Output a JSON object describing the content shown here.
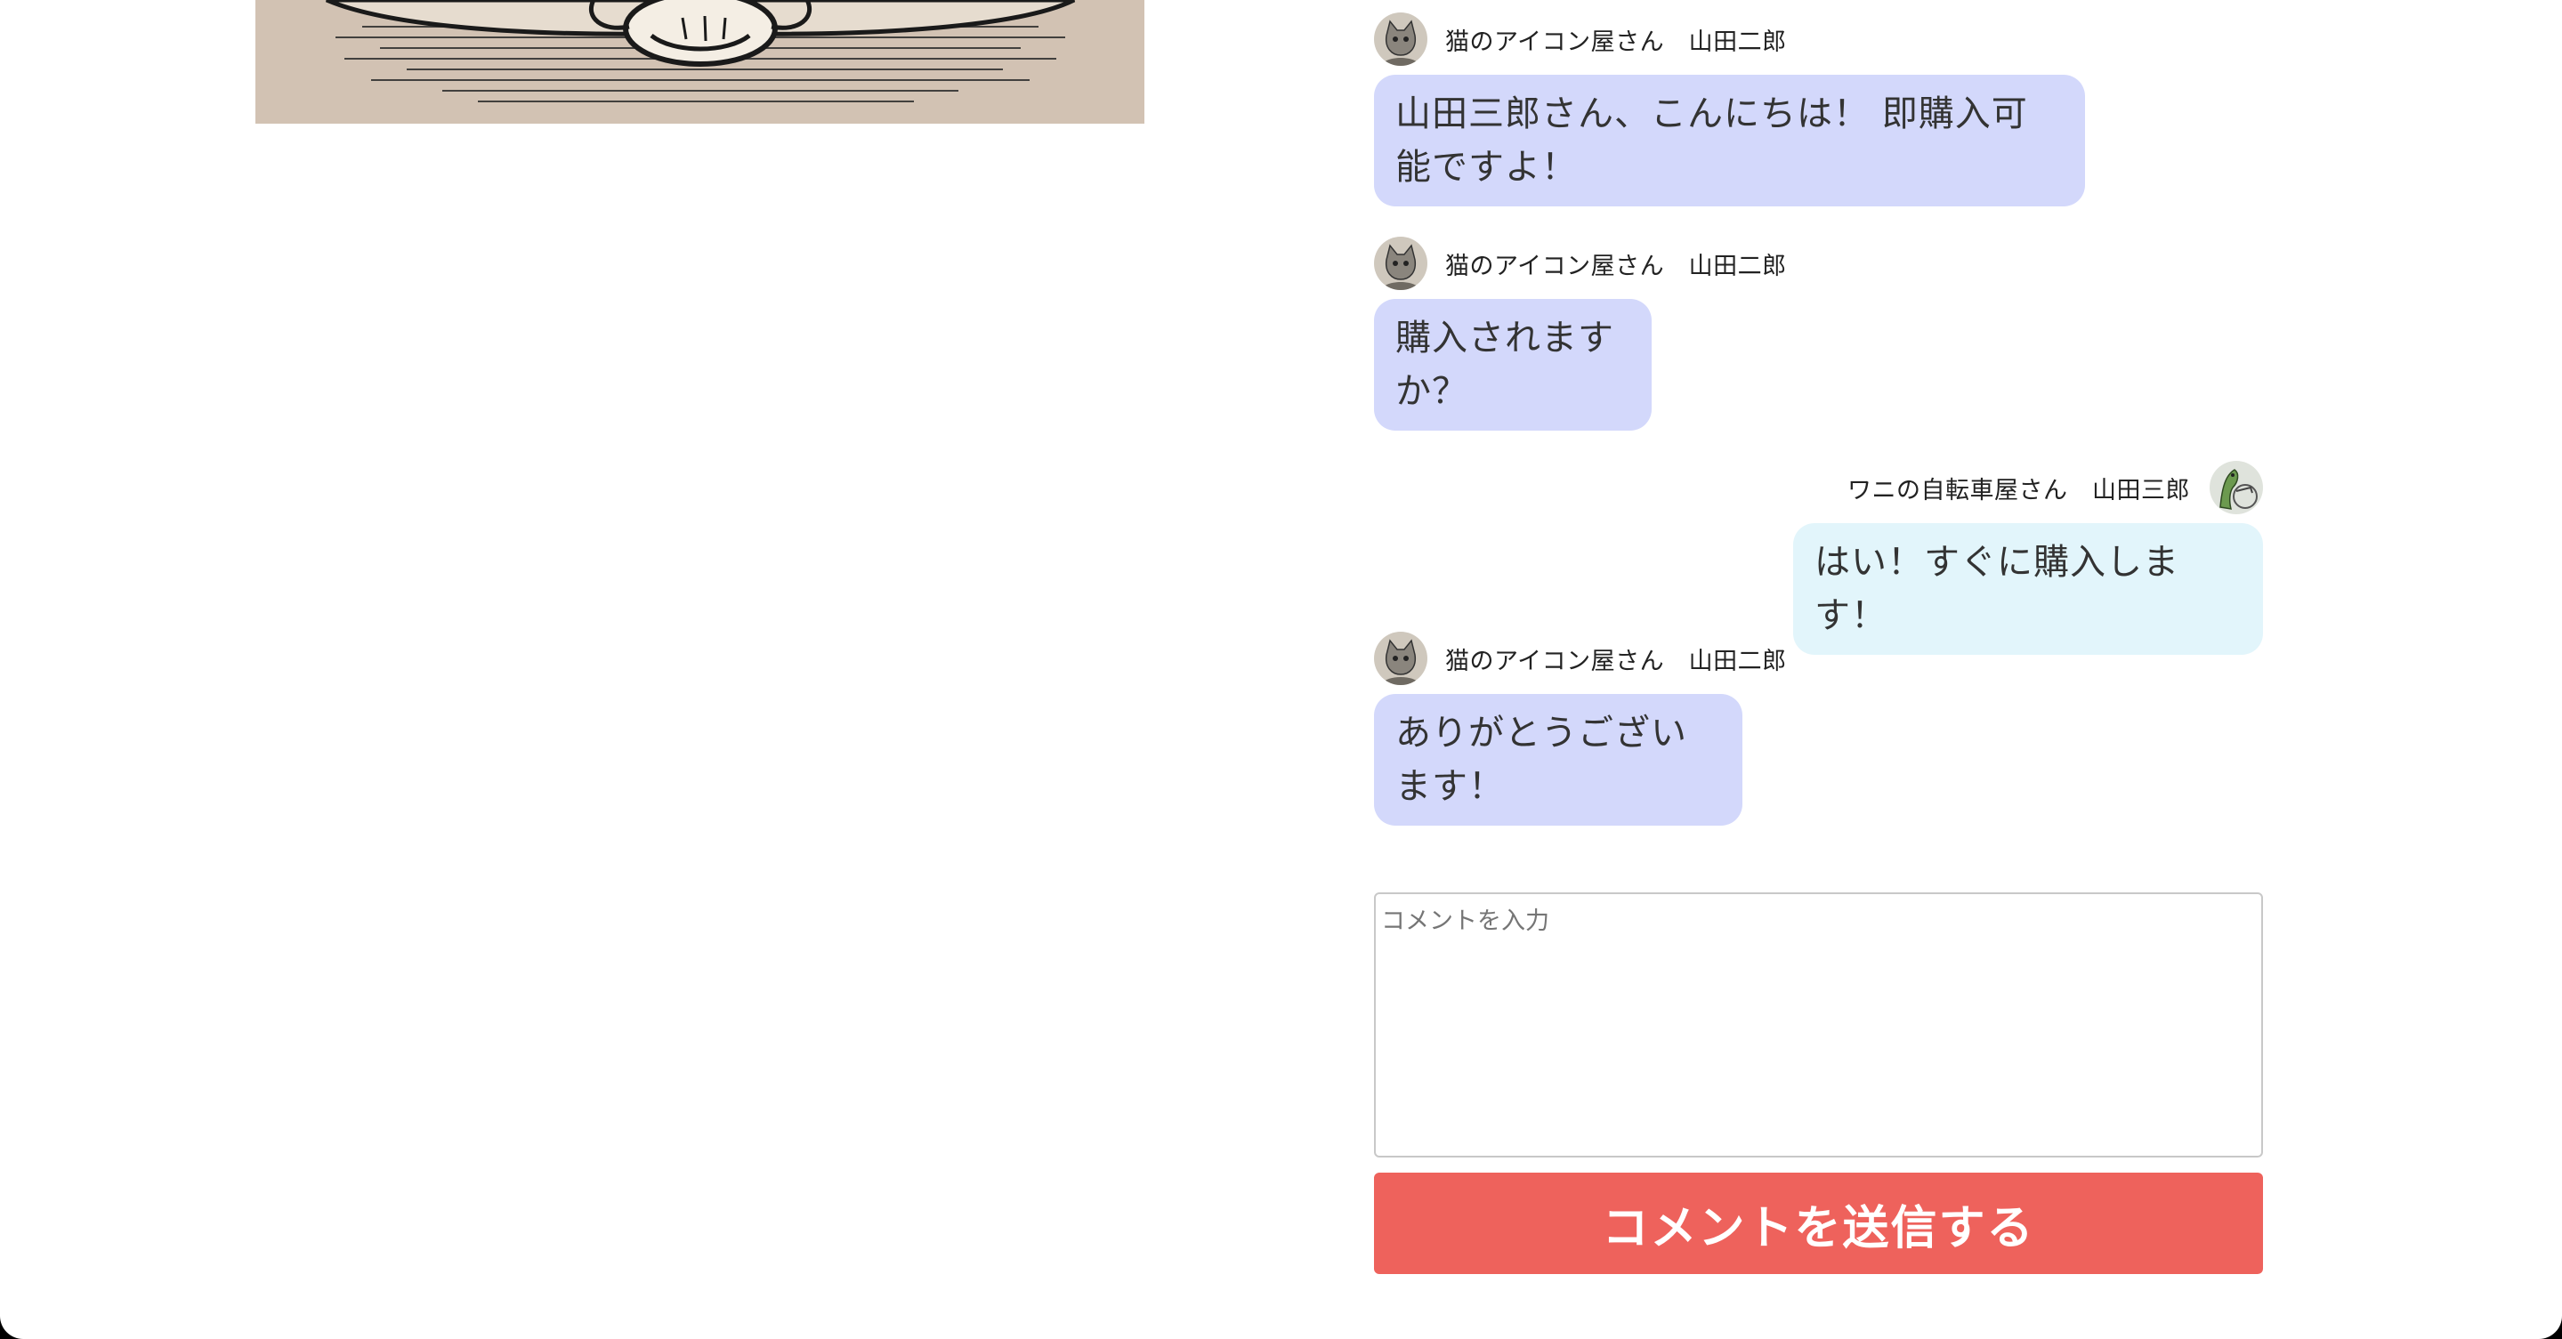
{
  "messages": [
    {
      "side": "left",
      "sender": "猫のアイコン屋さん　山田二郎",
      "avatar": "cat-avatar",
      "text": "山田三郎さん、こんにちは！ 即購入可能ですよ！"
    },
    {
      "side": "left",
      "sender": "猫のアイコン屋さん　山田二郎",
      "avatar": "cat-avatar",
      "text": "購入されますか？"
    },
    {
      "side": "right",
      "sender": "ワニの自転車屋さん　山田三郎",
      "avatar": "crocodile-avatar",
      "text": "はい！すぐに購入します！"
    },
    {
      "side": "left",
      "sender": "猫のアイコン屋さん　山田二郎",
      "avatar": "cat-avatar",
      "text": "ありがとうございます！"
    }
  ],
  "comment": {
    "placeholder": "コメントを入力",
    "value": ""
  },
  "submit_label": "コメントを送信する",
  "colors": {
    "seller_bubble": "#d3d8fb",
    "buyer_bubble": "#e2f5fb",
    "submit_button": "#ee625c",
    "image_background": "#d2c2b3"
  }
}
